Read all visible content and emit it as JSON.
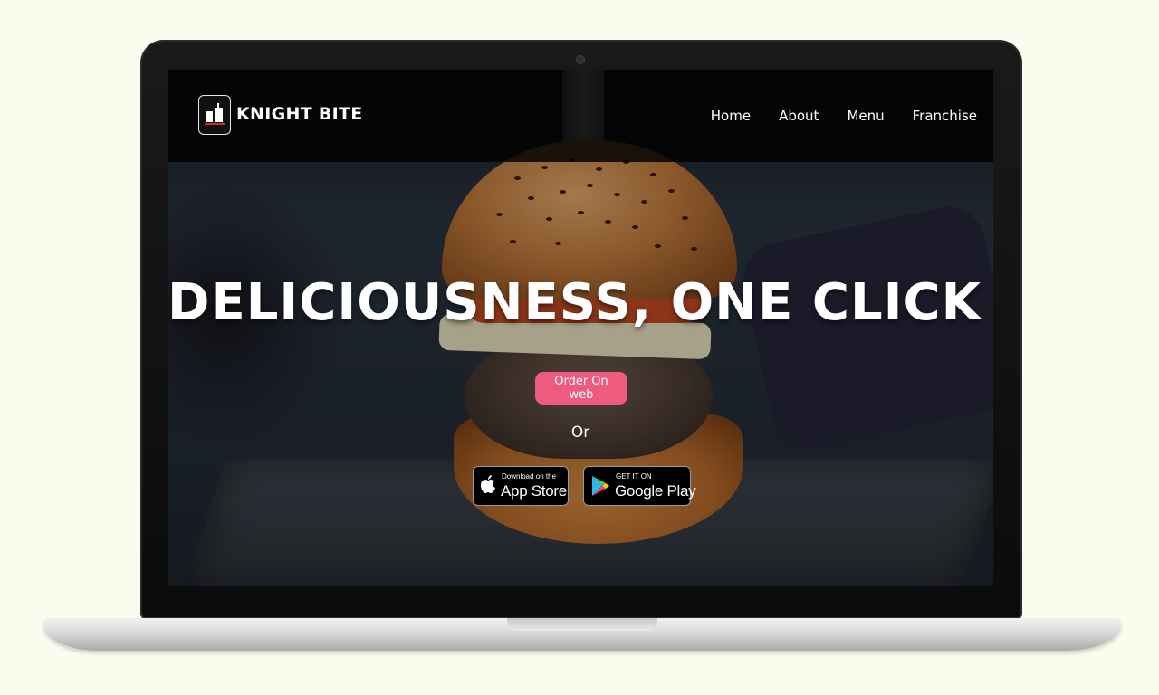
{
  "brand": {
    "name": "KNIGHT BITE"
  },
  "nav": {
    "items": [
      "Home",
      "About",
      "Menu",
      "Franchise"
    ]
  },
  "hero": {
    "title": "DELICIOUSNESS, ONE CLICK AWAY!",
    "order_button": "Order On web",
    "or_text": "Or"
  },
  "stores": {
    "apple": {
      "small": "Download on the",
      "big": "App Store",
      "icon": "apple-icon"
    },
    "google": {
      "small": "GET IT ON",
      "big": "Google Play",
      "icon": "google-play-icon"
    }
  },
  "colors": {
    "accent": "#ef5b7e",
    "page_bg": "#fbfcee"
  }
}
